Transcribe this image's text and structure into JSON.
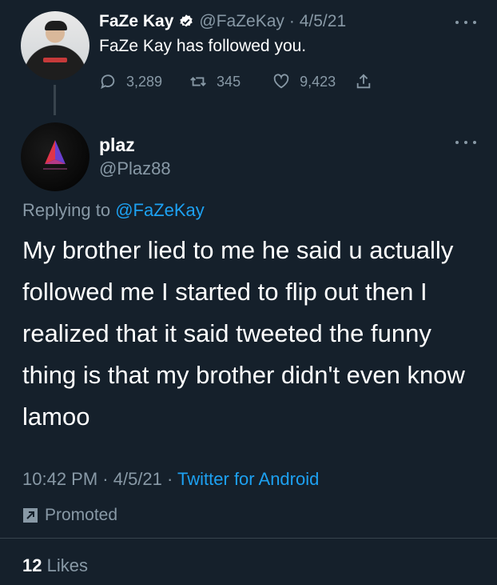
{
  "parent": {
    "name": "FaZe Kay",
    "handle": "@FaZeKay",
    "date": "· 4/5/21",
    "text": "FaZe Kay has followed you.",
    "replies": "3,289",
    "retweets": "345",
    "likes": "9,423"
  },
  "reply": {
    "name": "plaz",
    "handle": "@Plaz88",
    "replying_prefix": "Replying to ",
    "replying_to": "@FaZeKay",
    "text": "My brother lied to me he said u actually followed me I started to flip out then I realized that it said tweeted the funny thing is that my brother didn't even know lamoo",
    "time_date": "10:42 PM · 4/5/21 · ",
    "source": "Twitter for Android",
    "promoted": "Promoted",
    "likes_count": "12",
    "likes_label": "Likes"
  },
  "colors": {
    "background": "#15202b",
    "muted": "#8899a6",
    "accent": "#1da1f2",
    "divider": "#38444d"
  },
  "icons": [
    "verified-badge-icon",
    "reply-icon",
    "retweet-icon",
    "like-icon",
    "share-icon",
    "more-icon",
    "promoted-icon"
  ]
}
